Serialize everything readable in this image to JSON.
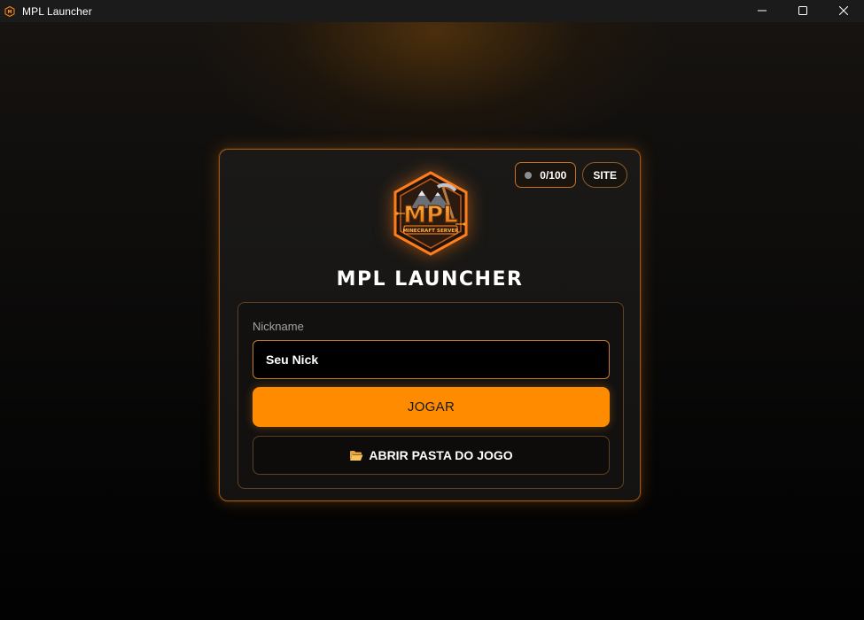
{
  "window": {
    "title": "MPL Launcher",
    "app_icon": "mpl-logo-icon",
    "controls": [
      "minimize-icon",
      "maximize-icon",
      "close-icon"
    ]
  },
  "card": {
    "title": "MPL LAUNCHER",
    "logo": {
      "icon": "mpl-minecraft-server-logo",
      "text_main": "MPL",
      "text_sub": "MINECRAFT SERVER"
    },
    "player_counter": {
      "value": "0/100",
      "status_color": "#8a8f96"
    },
    "site_button": "SITE"
  },
  "form": {
    "nickname_label": "Nickname",
    "nickname_value": "Seu Nick",
    "play_button": "JOGAR",
    "open_folder_button": "ABRIR PASTA DO JOGO",
    "open_folder_icon": "folder-icon"
  },
  "colors": {
    "accent": "#ff8c00",
    "border": "#a0581a",
    "background": "#050505"
  }
}
